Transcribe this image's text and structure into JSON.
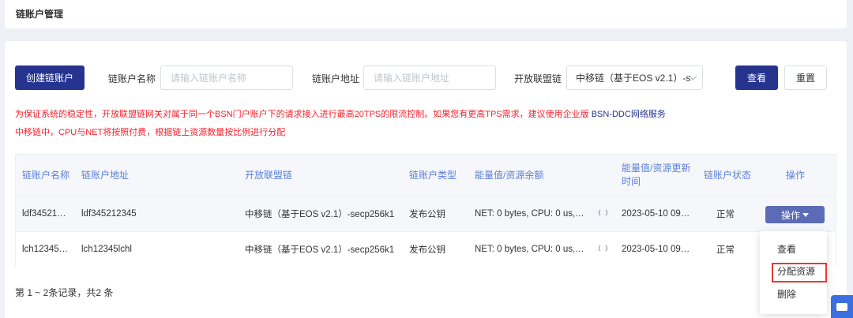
{
  "page": {
    "title": "链账户管理"
  },
  "toolbar": {
    "create_label": "创建链账户",
    "name_label": "链账户名称",
    "name_placeholder": "请输入链账户名称",
    "address_label": "链账户地址",
    "address_placeholder": "请输入链账户地址",
    "chain_label": "开放联盟链",
    "chain_value": "中移链（基于EOS v2.1）-s",
    "query_label": "查看",
    "reset_label": "重置"
  },
  "notice": {
    "line1": "为保证系统的稳定性，开放联盟链网关对属于同一个BSN门户账户下的请求接入进行最高20TPS的限流控制。如果您有更高TPS需求，建议使用企业版 ",
    "line1_link": "BSN-DDC网络服务",
    "line2": "中移链中，CPU与NET将按照付费，根据链上资源数量按比例进行分配"
  },
  "table": {
    "headers": {
      "name": "链账户名称",
      "address": "链账户地址",
      "chain": "开放联盟链",
      "type": "链账户类型",
      "energy": "能量值/资源余额",
      "update_time_1": "能量值/资源更新",
      "update_time_2": "时间",
      "status": "链账户状态",
      "action": "操作"
    },
    "rows": [
      {
        "name": "ldf34521…",
        "address": "ldf345212345",
        "chain": "中移链（基于EOS v2.1）-secp256k1",
        "type": "发布公钥",
        "energy": "NET: 0 bytes, CPU: 0 us,…",
        "time": "2023-05-10 09…",
        "status": "正常"
      },
      {
        "name": "lch12345…",
        "address": "lch12345lchl",
        "chain": "中移链（基于EOS v2.1）-secp256k1",
        "type": "发布公钥",
        "energy": "NET: 0 bytes, CPU: 0 us,…",
        "time": "2023-05-10 09…",
        "status": "正常"
      }
    ],
    "action_button": "操作"
  },
  "dropdown": {
    "items": [
      "查看",
      "分配资源",
      "删除"
    ]
  },
  "footer": {
    "summary": "第 1 ~ 2条记录，共2 条"
  },
  "colors": {
    "primary": "#26348f",
    "warning": "#f5222d",
    "header_text": "#5c7fd6",
    "highlight_box": "#e53935"
  }
}
